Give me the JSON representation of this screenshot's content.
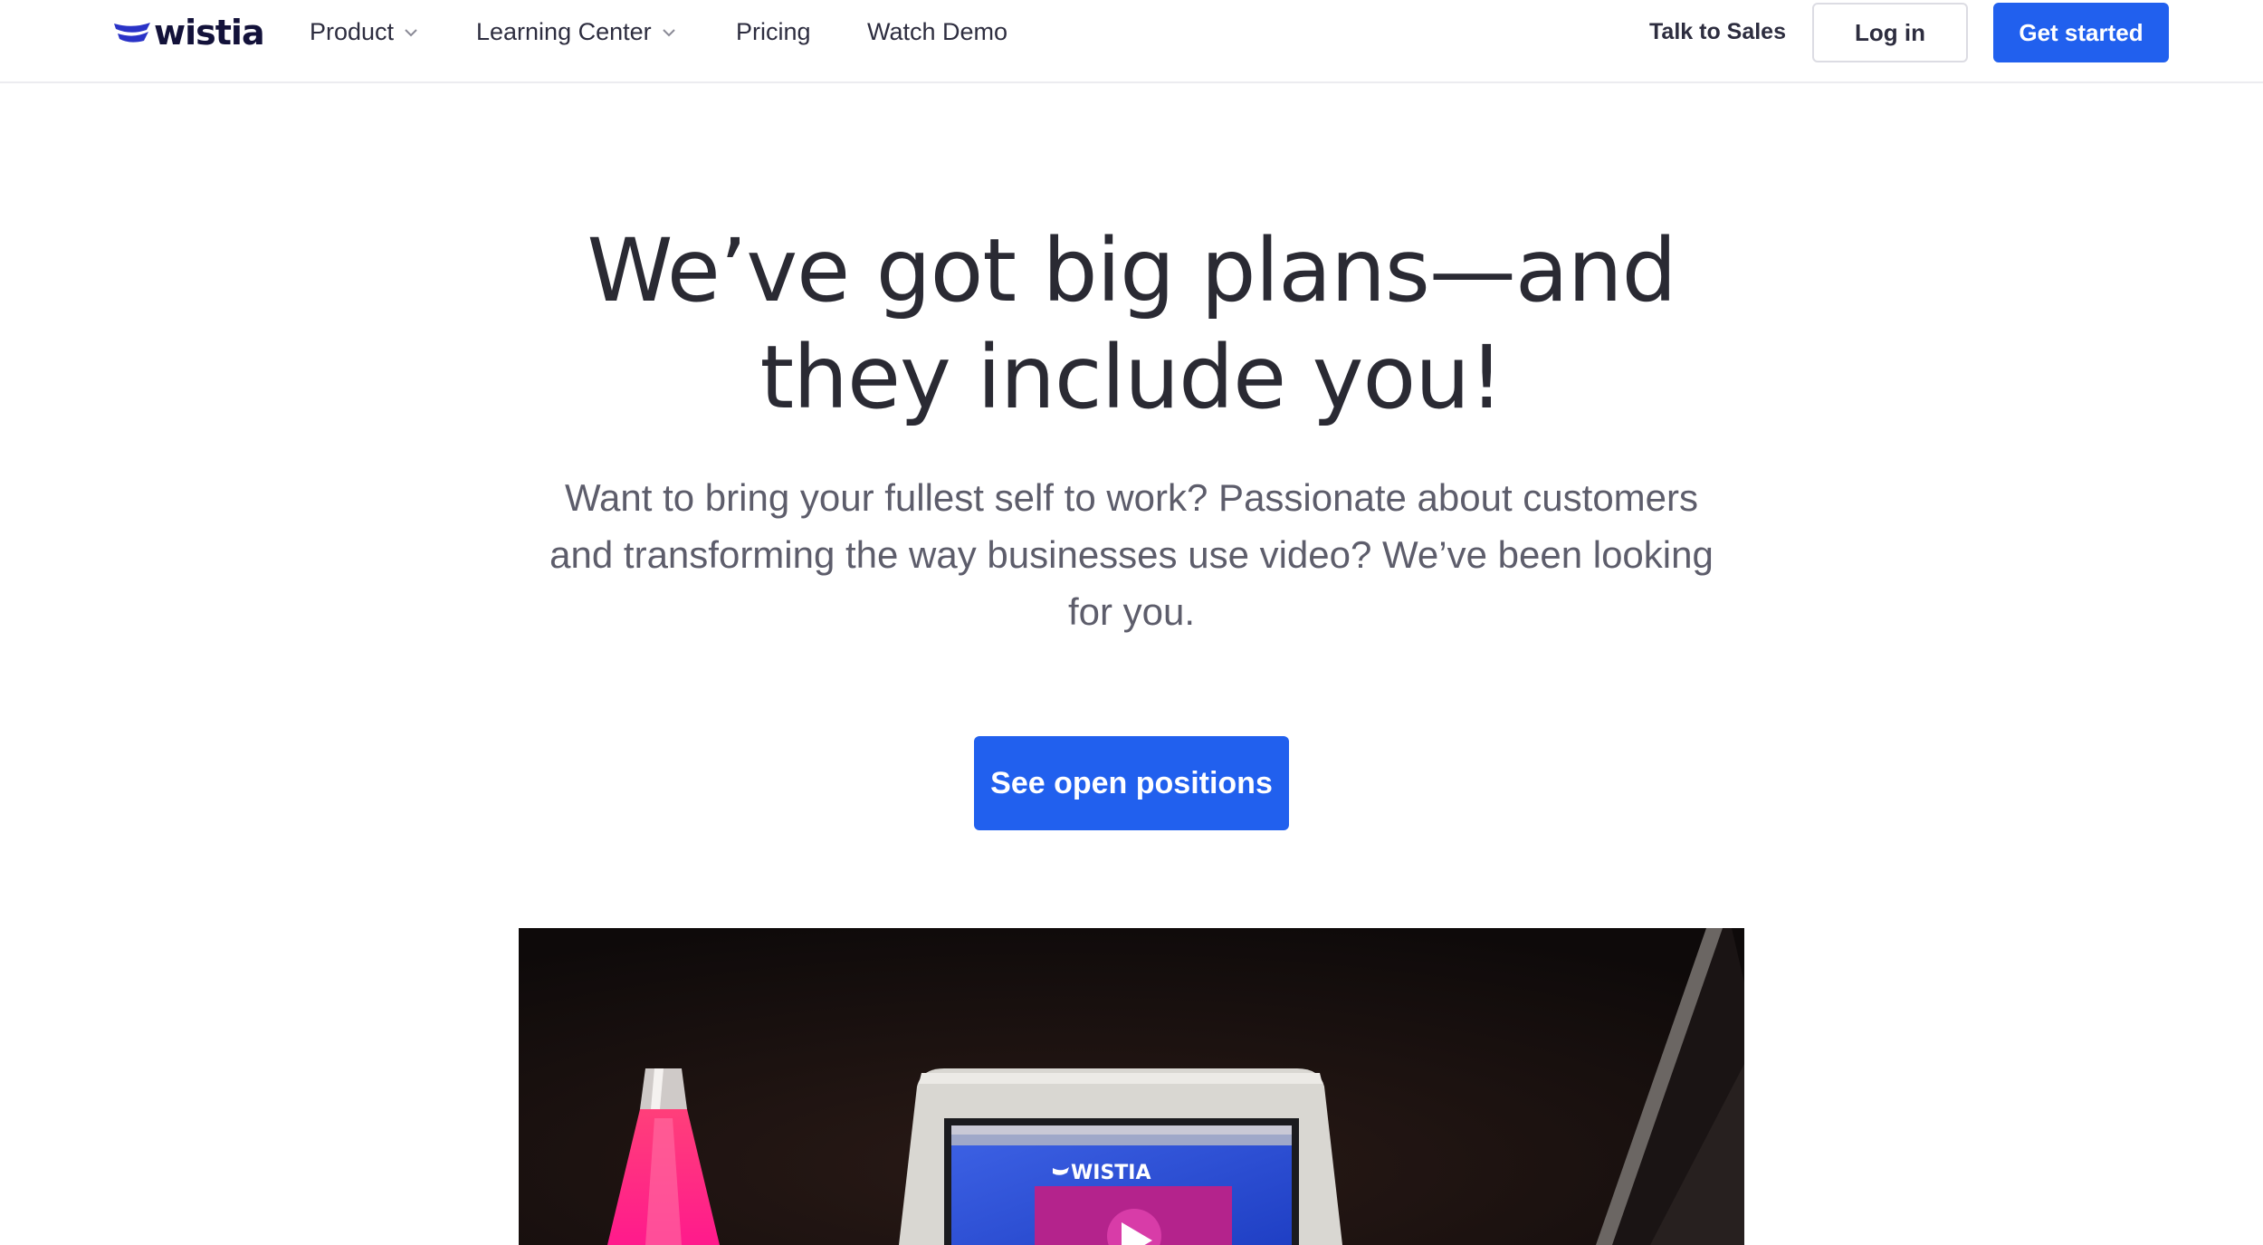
{
  "brand": {
    "name": "wistia",
    "color": "#2a33c7"
  },
  "nav": {
    "items": [
      {
        "label": "Product",
        "dropdown": true
      },
      {
        "label": "Learning Center",
        "dropdown": true
      },
      {
        "label": "Pricing",
        "dropdown": false
      },
      {
        "label": "Watch Demo",
        "dropdown": false
      }
    ],
    "talk_to_sales": "Talk to Sales",
    "login": "Log in",
    "get_started": "Get started"
  },
  "hero": {
    "title_line1": "We’ve got big plans—and",
    "title_line2": "they include you!",
    "subtitle_line1": "Want to bring your fullest self to work? Passionate about customers",
    "subtitle_line2": "and transforming the way businesses use video? We’ve been looking",
    "subtitle_line3": "for you.",
    "cta_label": "See open positions"
  },
  "video": {
    "screen_logo_text": "WISTIA"
  },
  "colors": {
    "accent": "#2160ee",
    "text_dark": "#2a2a33",
    "text_muted": "#5d5d6b"
  }
}
